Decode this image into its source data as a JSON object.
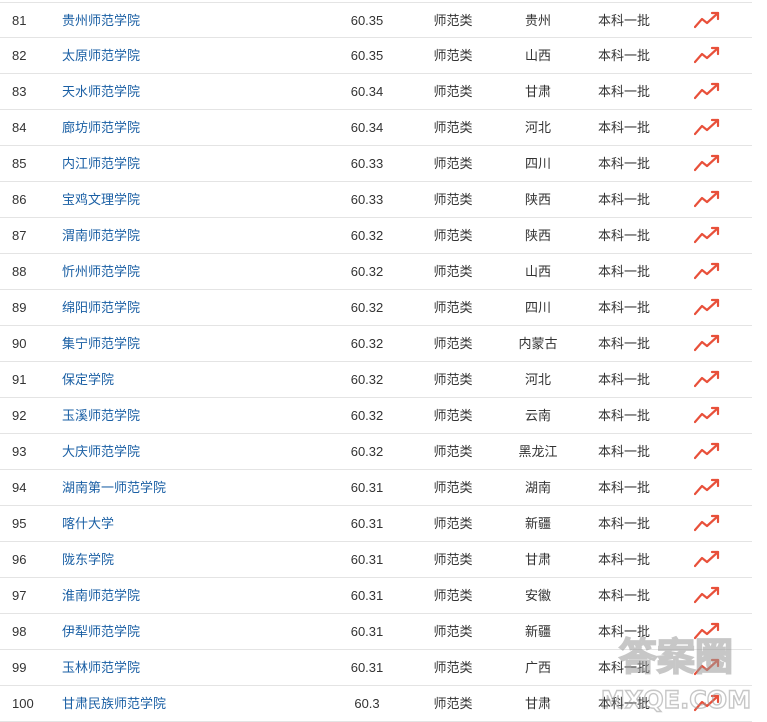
{
  "table": {
    "rows": [
      {
        "rank": "81",
        "name": "贵州师范学院",
        "score": "60.35",
        "type": "师范类",
        "province": "贵州",
        "batch": "本科一批"
      },
      {
        "rank": "82",
        "name": "太原师范学院",
        "score": "60.35",
        "type": "师范类",
        "province": "山西",
        "batch": "本科一批"
      },
      {
        "rank": "83",
        "name": "天水师范学院",
        "score": "60.34",
        "type": "师范类",
        "province": "甘肃",
        "batch": "本科一批"
      },
      {
        "rank": "84",
        "name": "廊坊师范学院",
        "score": "60.34",
        "type": "师范类",
        "province": "河北",
        "batch": "本科一批"
      },
      {
        "rank": "85",
        "name": "内江师范学院",
        "score": "60.33",
        "type": "师范类",
        "province": "四川",
        "batch": "本科一批"
      },
      {
        "rank": "86",
        "name": "宝鸡文理学院",
        "score": "60.33",
        "type": "师范类",
        "province": "陕西",
        "batch": "本科一批"
      },
      {
        "rank": "87",
        "name": "渭南师范学院",
        "score": "60.32",
        "type": "师范类",
        "province": "陕西",
        "batch": "本科一批"
      },
      {
        "rank": "88",
        "name": "忻州师范学院",
        "score": "60.32",
        "type": "师范类",
        "province": "山西",
        "batch": "本科一批"
      },
      {
        "rank": "89",
        "name": "绵阳师范学院",
        "score": "60.32",
        "type": "师范类",
        "province": "四川",
        "batch": "本科一批"
      },
      {
        "rank": "90",
        "name": "集宁师范学院",
        "score": "60.32",
        "type": "师范类",
        "province": "内蒙古",
        "batch": "本科一批"
      },
      {
        "rank": "91",
        "name": "保定学院",
        "score": "60.32",
        "type": "师范类",
        "province": "河北",
        "batch": "本科一批"
      },
      {
        "rank": "92",
        "name": "玉溪师范学院",
        "score": "60.32",
        "type": "师范类",
        "province": "云南",
        "batch": "本科一批"
      },
      {
        "rank": "93",
        "name": "大庆师范学院",
        "score": "60.32",
        "type": "师范类",
        "province": "黑龙江",
        "batch": "本科一批"
      },
      {
        "rank": "94",
        "name": "湖南第一师范学院",
        "score": "60.31",
        "type": "师范类",
        "province": "湖南",
        "batch": "本科一批"
      },
      {
        "rank": "95",
        "name": "喀什大学",
        "score": "60.31",
        "type": "师范类",
        "province": "新疆",
        "batch": "本科一批"
      },
      {
        "rank": "96",
        "name": "陇东学院",
        "score": "60.31",
        "type": "师范类",
        "province": "甘肃",
        "batch": "本科一批"
      },
      {
        "rank": "97",
        "name": "淮南师范学院",
        "score": "60.31",
        "type": "师范类",
        "province": "安徽",
        "batch": "本科一批"
      },
      {
        "rank": "98",
        "name": "伊犁师范学院",
        "score": "60.31",
        "type": "师范类",
        "province": "新疆",
        "batch": "本科一批"
      },
      {
        "rank": "99",
        "name": "玉林师范学院",
        "score": "60.31",
        "type": "师范类",
        "province": "广西",
        "batch": "本科一批"
      },
      {
        "rank": "100",
        "name": "甘肃民族师范学院",
        "score": "60.3",
        "type": "师范类",
        "province": "甘肃",
        "batch": "本科一批"
      }
    ],
    "trend_icon": "trend-up-icon",
    "trend_color": "#e8503a",
    "link_color": "#1a5fa4"
  },
  "watermark": {
    "line1": "答案圈",
    "line2": "MXQE.COM"
  }
}
